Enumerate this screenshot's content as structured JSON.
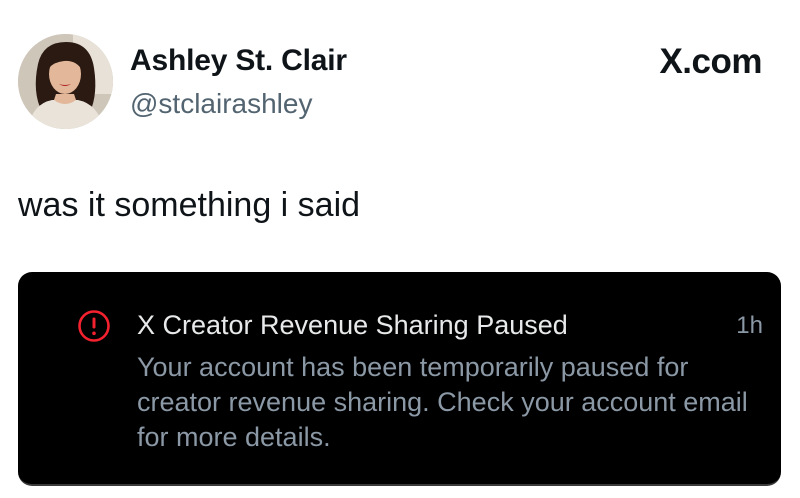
{
  "tweet": {
    "author": {
      "display_name": "Ashley St. Clair",
      "handle": "@stclairashley",
      "avatar_icon": "profile-photo"
    },
    "brand": "X.com",
    "text": "was it something i said"
  },
  "notification": {
    "icon": "alert-circle-icon",
    "title": "X Creator Revenue Sharing Paused",
    "time": "1h",
    "body": "Your account has been temporarily paused for creator revenue sharing. Check your account email for more details."
  },
  "colors": {
    "text_primary": "#0f1419",
    "text_secondary": "#536471",
    "card_background": "#000000",
    "card_title": "#e7e9ea",
    "card_body": "#8b98a5",
    "alert_red": "#f4212e"
  }
}
